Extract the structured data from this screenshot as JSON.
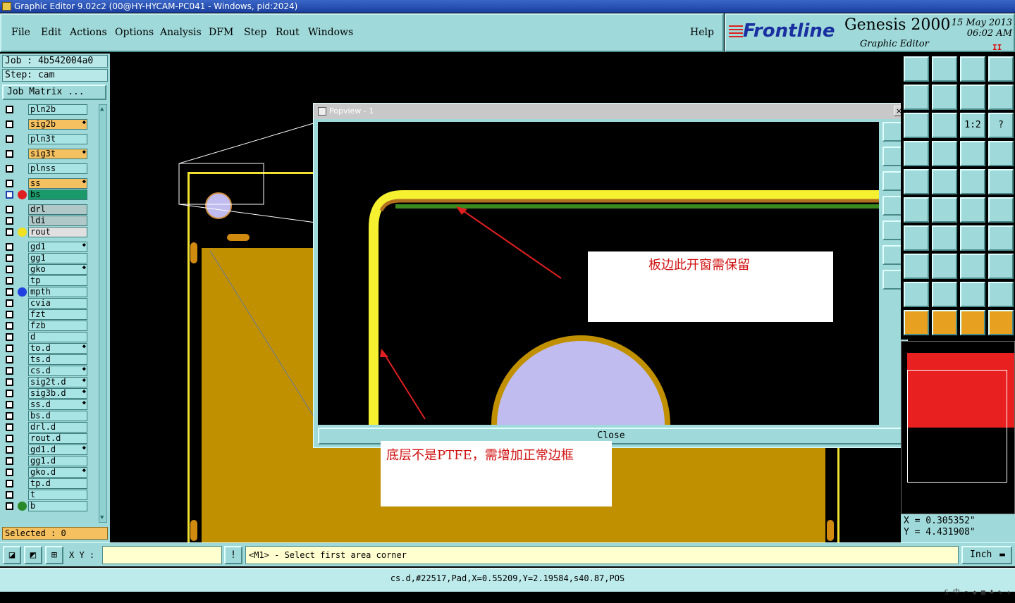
{
  "window": {
    "title": "Graphic Editor 9.02c2 (00@HY-HYCAM-PC041 - Windows, pid:2024)",
    "buttons": [
      "_",
      "□",
      "×"
    ]
  },
  "menu": [
    "File",
    "Edit",
    "Actions",
    "Options",
    "Analysis",
    "DFM",
    "Step",
    "Rout",
    "Windows",
    "Help"
  ],
  "brand": {
    "logo": "Frontline",
    "product": "Genesis 2000",
    "subtitle": "Graphic Editor",
    "date": "15 May 2013",
    "time": "06:02 AM",
    "pause": "II"
  },
  "job": {
    "job_line": "Job : 4b542004a0",
    "step_line": "Step: cam",
    "matrix_button": "Job Matrix ..."
  },
  "layers": [
    {
      "name": "pln2b",
      "color": "",
      "dot": "",
      "leaf": false
    },
    {
      "name": "sig2b",
      "color": "#f5c060",
      "dot": "",
      "leaf": true
    },
    {
      "name": "pln3t",
      "color": "",
      "dot": "",
      "leaf": false
    },
    {
      "name": "sig3t",
      "color": "#f5c060",
      "dot": "",
      "leaf": true
    },
    {
      "name": "plnss",
      "color": "",
      "dot": "",
      "leaf": false
    },
    {
      "name": "ss",
      "color": "#f5c060",
      "dot": "",
      "leaf": true
    },
    {
      "name": "bs",
      "color": "#1a9a6a",
      "dot": "#e02020",
      "leaf": false
    },
    {
      "name": "drl",
      "color": "#b0c8c8",
      "dot": "",
      "leaf": false
    },
    {
      "name": "ldi",
      "color": "#b0c8c8",
      "dot": "",
      "leaf": false
    },
    {
      "name": "rout",
      "color": "#e0e0e0",
      "dot": "#f0e020",
      "leaf": false
    },
    {
      "name": "gd1",
      "color": "",
      "dot": "",
      "leaf": true
    },
    {
      "name": "gg1",
      "color": "",
      "dot": "",
      "leaf": false
    },
    {
      "name": "gko",
      "color": "",
      "dot": "",
      "leaf": true
    },
    {
      "name": "tp",
      "color": "",
      "dot": "",
      "leaf": false
    },
    {
      "name": "mpth",
      "color": "",
      "dot": "#2040e0",
      "leaf": false
    },
    {
      "name": "cvia",
      "color": "",
      "dot": "",
      "leaf": false
    },
    {
      "name": "fzt",
      "color": "",
      "dot": "",
      "leaf": false
    },
    {
      "name": "fzb",
      "color": "",
      "dot": "",
      "leaf": false
    },
    {
      "name": "d",
      "color": "",
      "dot": "",
      "leaf": false
    },
    {
      "name": "to.d",
      "color": "",
      "dot": "",
      "leaf": true
    },
    {
      "name": "ts.d",
      "color": "",
      "dot": "",
      "leaf": false
    },
    {
      "name": "cs.d",
      "color": "",
      "dot": "",
      "leaf": true
    },
    {
      "name": "sig2t.d",
      "color": "",
      "dot": "",
      "leaf": true
    },
    {
      "name": "sig3b.d",
      "color": "",
      "dot": "",
      "leaf": true
    },
    {
      "name": "ss.d",
      "color": "",
      "dot": "",
      "leaf": true
    },
    {
      "name": "bs.d",
      "color": "",
      "dot": "",
      "leaf": false
    },
    {
      "name": "drl.d",
      "color": "",
      "dot": "",
      "leaf": false
    },
    {
      "name": "rout.d",
      "color": "",
      "dot": "",
      "leaf": false
    },
    {
      "name": "gd1.d",
      "color": "",
      "dot": "",
      "leaf": true
    },
    {
      "name": "gg1.d",
      "color": "",
      "dot": "",
      "leaf": false
    },
    {
      "name": "gko.d",
      "color": "",
      "dot": "",
      "leaf": true
    },
    {
      "name": "tp.d",
      "color": "",
      "dot": "",
      "leaf": false
    },
    {
      "name": "t",
      "color": "",
      "dot": "",
      "leaf": false
    },
    {
      "name": "b",
      "color": "",
      "dot": "#2a8a2a",
      "leaf": false
    }
  ],
  "selected": "Selected : 0",
  "popview": {
    "title": "Popview - 1",
    "close_label": "Close",
    "callout1": "板边此开窗需保留"
  },
  "callout2": "底层不是PTFE，需增加正常边框",
  "right_tools": [
    "",
    "",
    "",
    "",
    "",
    "",
    "",
    "",
    "",
    "",
    "1:2",
    "?",
    "",
    "",
    "",
    "",
    "",
    "",
    "",
    "",
    "",
    "",
    "",
    "",
    "",
    "",
    "",
    "",
    "",
    "",
    "",
    "",
    "",
    "",
    "",
    "",
    "",
    "",
    "",
    ""
  ],
  "coords": {
    "x": "X = 0.305352\"",
    "y": "Y = 4.431908\""
  },
  "bottom": {
    "xy_label": "X Y :",
    "xy_value": "",
    "prompt": "<M1> - Select first area corner",
    "units": "Inch"
  },
  "status": "cs.d,#22517,Pad,X=0.55209,Y=2.19584,s40.87,POS",
  "tray": "S 中 ⌒ ◆ ▦ ♣ ✎ ✈"
}
